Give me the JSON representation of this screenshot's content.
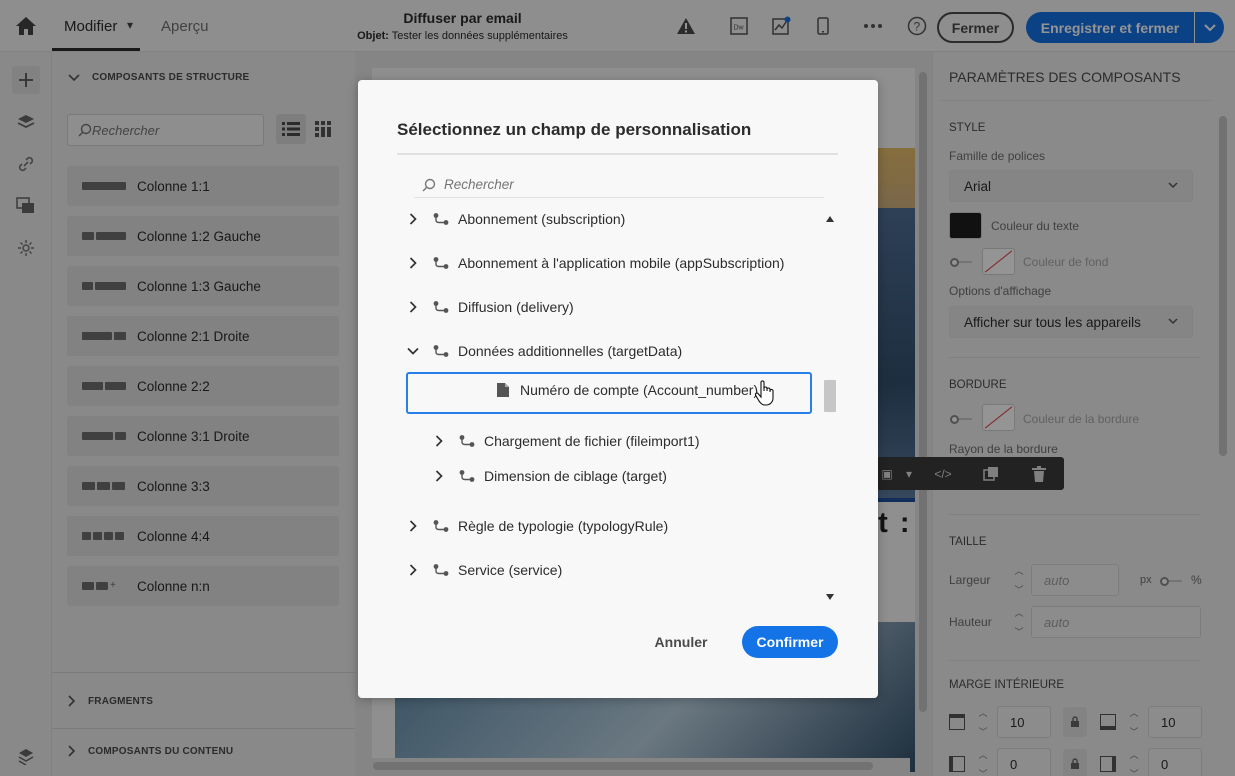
{
  "header": {
    "tabs": [
      {
        "label": "Modifier"
      },
      {
        "label": "Aperçu"
      }
    ],
    "title": "Diffuser par email",
    "subject_label": "Objet:",
    "subject_value": "Tester les données supplémentaires",
    "close_label": "Fermer",
    "save_label": "Enregistrer et fermer",
    "icons": [
      "home-icon",
      "warning-icon",
      "dreamweaver-icon",
      "test-chart-icon",
      "mobile-icon",
      "more-icon",
      "help-icon"
    ],
    "accent_color": "#1473e6"
  },
  "rail": {
    "icons": [
      "add-icon",
      "layers-icon",
      "link-icon",
      "images-icon",
      "personalization-icon",
      "structure-icon"
    ]
  },
  "left_panel": {
    "structure_heading": "COMPOSANTS DE STRUCTURE",
    "search_placeholder": "Rechercher",
    "components": [
      {
        "label": "Colonne 1:1"
      },
      {
        "label": "Colonne 1:2 Gauche"
      },
      {
        "label": "Colonne 1:3 Gauche"
      },
      {
        "label": "Colonne 2:1 Droite"
      },
      {
        "label": "Colonne 2:2"
      },
      {
        "label": "Colonne 3:1 Droite"
      },
      {
        "label": "Colonne 3:3"
      },
      {
        "label": "Colonne 4:4"
      },
      {
        "label": "Colonne n:n"
      }
    ],
    "fragments_heading": "FRAGMENTS",
    "content_heading": "COMPOSANTS DU CONTENU"
  },
  "canvas": {
    "visible_text": "st :"
  },
  "right_panel": {
    "title": "PARAMÈTRES DES COMPOSANTS",
    "style_heading": "STYLE",
    "font_family_label": "Famille de polices",
    "font_family_value": "Arial",
    "text_color_label": "Couleur du texte",
    "text_color": "#1e1e1e",
    "bg_color_label": "Couleur de fond",
    "display_options_label": "Options d'affichage",
    "display_options_value": "Afficher sur tous les appareils",
    "border_heading": "BORDURE",
    "border_color_label": "Couleur de la bordure",
    "border_radius_label": "Rayon de la bordure",
    "size_heading": "TAILLE",
    "width_label": "Largeur",
    "width_placeholder": "auto",
    "height_label": "Hauteur",
    "height_placeholder": "auto",
    "unit_px": "px",
    "unit_pct": "%",
    "padding_heading": "MARGE INTÉRIEURE",
    "padding_top": "10",
    "padding_bottom": "10",
    "padding_left": "0",
    "padding_right": "0"
  },
  "modal": {
    "title": "Sélectionnez un champ de personnalisation",
    "search_placeholder": "Rechercher",
    "tree": [
      {
        "label": "Abonnement (subscription)",
        "level": 0,
        "expanded": false,
        "type": "link"
      },
      {
        "label": "Abonnement à l'application mobile (appSubscription)",
        "level": 0,
        "expanded": false,
        "type": "link"
      },
      {
        "label": "Diffusion (delivery)",
        "level": 0,
        "expanded": false,
        "type": "link"
      },
      {
        "label": "Données additionnelles (targetData)",
        "level": 0,
        "expanded": true,
        "type": "link"
      },
      {
        "label": "Numéro de compte (Account_number)",
        "level": 1,
        "type": "field",
        "selected": true
      },
      {
        "label": "Chargement de fichier (fileimport1)",
        "level": 1,
        "expanded": false,
        "type": "link"
      },
      {
        "label": "Dimension de ciblage (target)",
        "level": 1,
        "expanded": false,
        "type": "link"
      },
      {
        "label": "Règle de typologie (typologyRule)",
        "level": 0,
        "expanded": false,
        "type": "link"
      },
      {
        "label": "Service (service)",
        "level": 0,
        "expanded": false,
        "type": "link"
      }
    ],
    "cancel_label": "Annuler",
    "confirm_label": "Confirmer"
  }
}
